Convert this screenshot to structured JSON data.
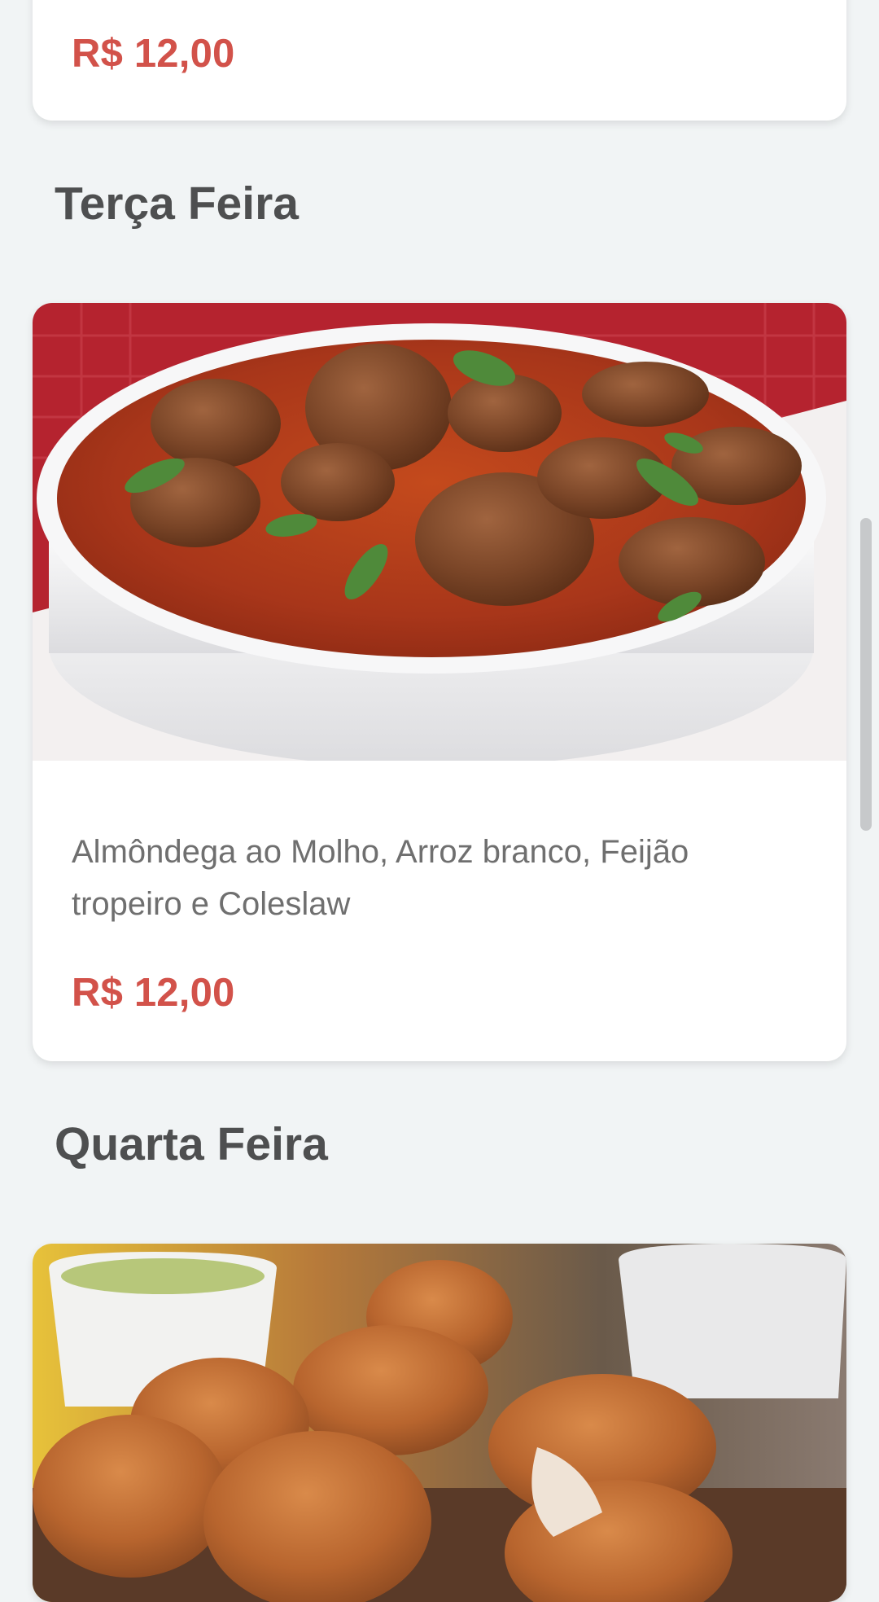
{
  "menu": {
    "previous_item": {
      "price": "R$ 12,00"
    },
    "tuesday": {
      "day_label": "Terça Feira",
      "image_icon": "meatballs-in-tomato-sauce-photo",
      "description": "Almôndega ao Molho, Arroz branco, Feijão tropeiro e Coleslaw",
      "price": "R$ 12,00"
    },
    "wednesday": {
      "day_label": "Quarta Feira",
      "image_icon": "fried-chicken-photo"
    }
  },
  "colors": {
    "background": "#f1f4f5",
    "card": "#ffffff",
    "price": "#d2524a",
    "heading": "#4e4f50",
    "description": "#6f6f6f"
  }
}
